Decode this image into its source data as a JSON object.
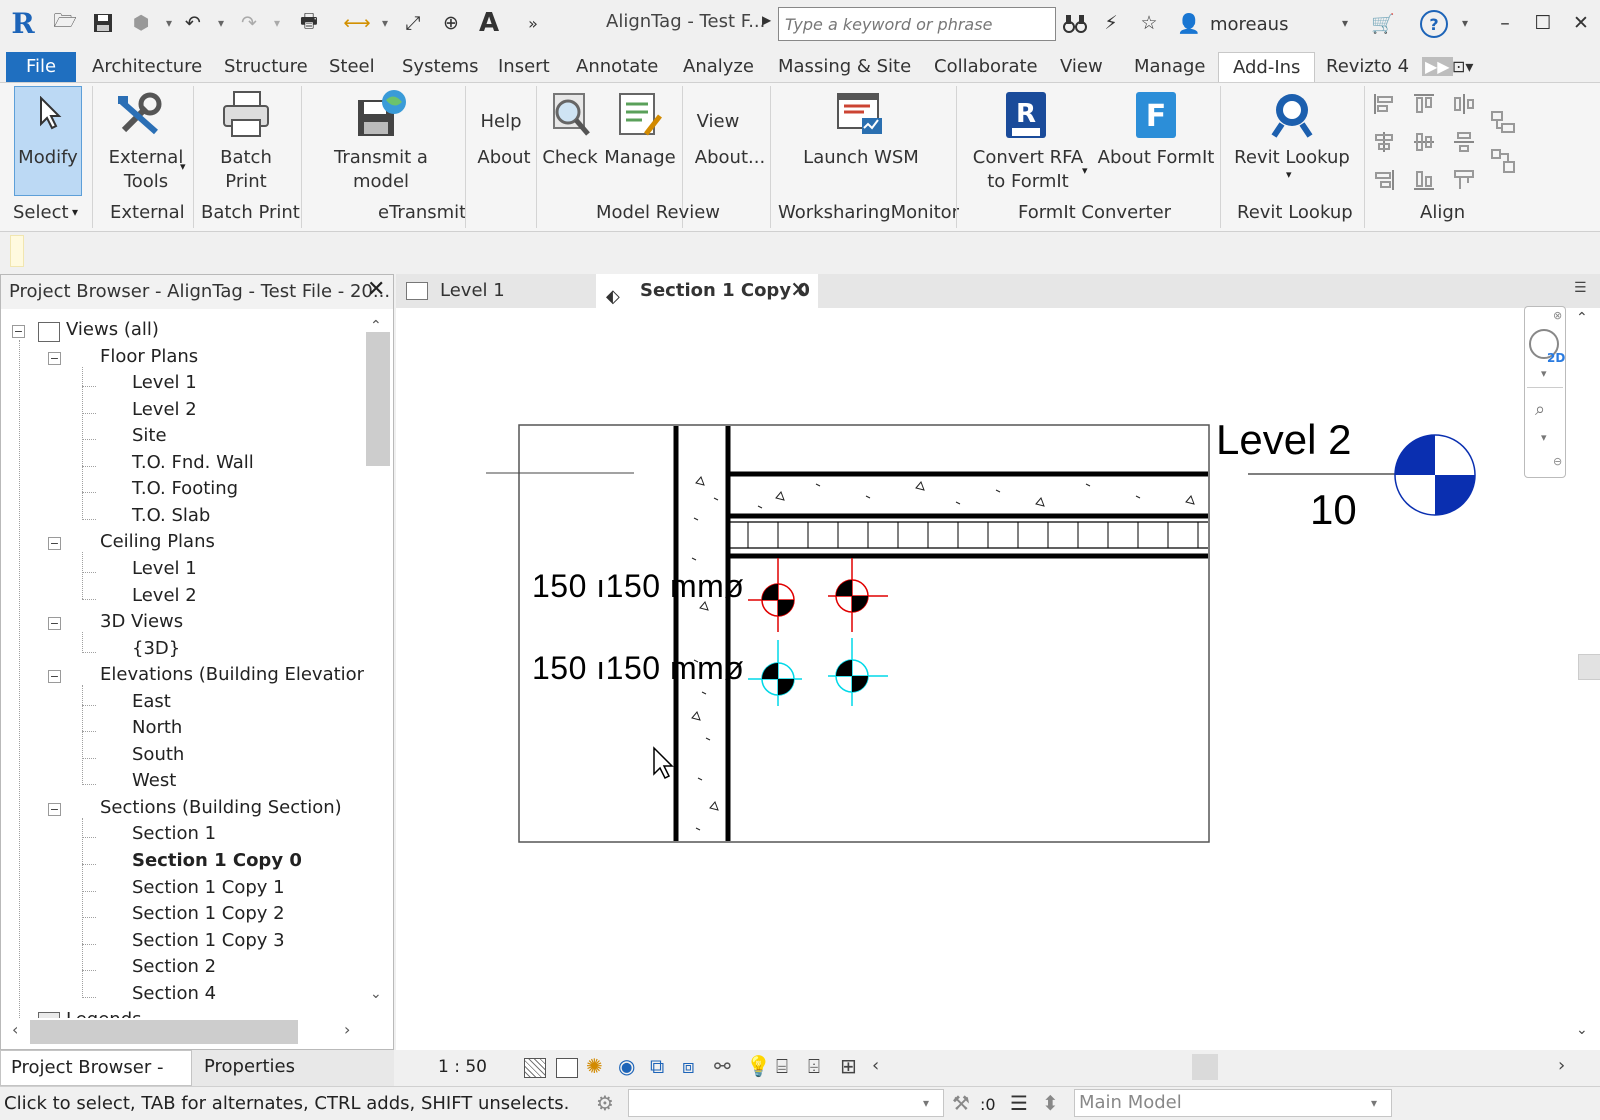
{
  "app": {
    "window_title": "AlignTag - Test F...",
    "search_placeholder": "Type a keyword or phrase",
    "user": "moreaus"
  },
  "menu": [
    "File",
    "Architecture",
    "Structure",
    "Steel",
    "Systems",
    "Insert",
    "Annotate",
    "Analyze",
    "Massing & Site",
    "Collaborate",
    "View",
    "Manage",
    "Add-Ins",
    "Revizto 4"
  ],
  "active_menu": "Add-Ins",
  "ribbon": {
    "modify": "Modify",
    "external_tools": [
      "External",
      "Tools"
    ],
    "batch_print": "Batch Print",
    "transmit": "Transmit a model",
    "help": "Help",
    "about": "About",
    "check": "Check",
    "manage": "Manage",
    "view": "View",
    "about2": "About...",
    "launch_wsm": "Launch WSM",
    "convert_rfa": [
      "Convert RFA",
      "to FormIt"
    ],
    "about_formit": "About FormIt",
    "revit_lookup": "Revit Lookup",
    "panels": {
      "select": "Select",
      "external": "External",
      "batch_print": "Batch Print",
      "etransmit": "eTransmit",
      "model_review": "Model Review",
      "wsm": "WorksharingMonitor",
      "formit": "FormIt Converter",
      "revit_lookup": "Revit Lookup",
      "align": "Align"
    }
  },
  "project_browser": {
    "title": "Project Browser - AlignTag - Test File - 20...",
    "tree": [
      {
        "label": "Views (all)",
        "level": 0,
        "toggle": "-"
      },
      {
        "label": "Floor Plans",
        "level": 1,
        "toggle": "-"
      },
      {
        "label": "Level 1",
        "level": 2
      },
      {
        "label": "Level 2",
        "level": 2
      },
      {
        "label": "Site",
        "level": 2
      },
      {
        "label": "T.O. Fnd. Wall",
        "level": 2
      },
      {
        "label": "T.O. Footing",
        "level": 2
      },
      {
        "label": "T.O. Slab",
        "level": 2
      },
      {
        "label": "Ceiling Plans",
        "level": 1,
        "toggle": "-"
      },
      {
        "label": "Level 1",
        "level": 2
      },
      {
        "label": "Level 2",
        "level": 2
      },
      {
        "label": "3D Views",
        "level": 1,
        "toggle": "-"
      },
      {
        "label": "{3D}",
        "level": 2
      },
      {
        "label": "Elevations (Building Elevation)",
        "level": 1,
        "toggle": "-"
      },
      {
        "label": "East",
        "level": 2
      },
      {
        "label": "North",
        "level": 2
      },
      {
        "label": "South",
        "level": 2
      },
      {
        "label": "West",
        "level": 2
      },
      {
        "label": "Sections (Building Section)",
        "level": 1,
        "toggle": "-"
      },
      {
        "label": "Section 1",
        "level": 2
      },
      {
        "label": "Section 1 Copy 0",
        "level": 2,
        "bold": true
      },
      {
        "label": "Section 1 Copy 1",
        "level": 2
      },
      {
        "label": "Section 1 Copy 2",
        "level": 2
      },
      {
        "label": "Section 1 Copy 3",
        "level": 2
      },
      {
        "label": "Section 2",
        "level": 2
      },
      {
        "label": "Section 4",
        "level": 2
      },
      {
        "label": "Legends",
        "level": 0
      }
    ],
    "bottom_tabs": [
      "Project Browser - A...",
      "Properties"
    ]
  },
  "doc_tabs": [
    "Level 1",
    "Section 1 Copy 0"
  ],
  "drawing": {
    "level_name": "Level 2",
    "level_value": "10",
    "tag_red": "150 ı150 mmø",
    "tag_cyan": "150 ı150 mmø"
  },
  "view_bar": {
    "scale": "1 : 50"
  },
  "status": {
    "message": "Click to select, TAB for alternates, CTRL adds, SHIFT unselects.",
    "workset_count": ":0",
    "model": "Main Model"
  },
  "colors": {
    "accent": "#1f6fc0",
    "tag_red": "#e00000",
    "tag_cyan": "#00d8e8",
    "level_blue": "#0a2fb0"
  }
}
